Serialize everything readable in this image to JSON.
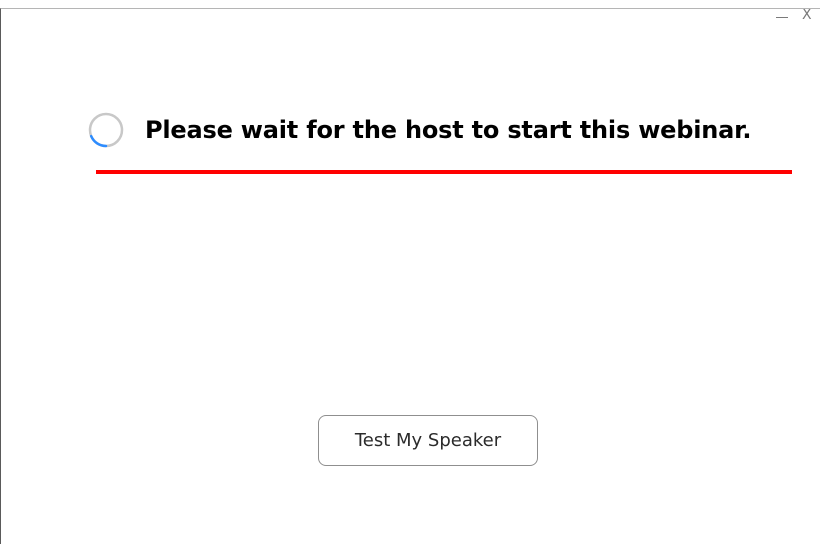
{
  "window": {
    "controls": {
      "minimize_icon": "minimize-icon",
      "close_label": "X"
    }
  },
  "status": {
    "spinner_icon": "loading-spinner-icon",
    "message": "Please wait for the host to start this webinar."
  },
  "annotation": {
    "underline_color": "#ff0000"
  },
  "actions": {
    "test_speaker_label": "Test My Speaker"
  },
  "colors": {
    "spinner_track": "#c8c8c8",
    "spinner_accent": "#2d8cff",
    "text": "#000000",
    "button_border": "#8f8f8f"
  }
}
